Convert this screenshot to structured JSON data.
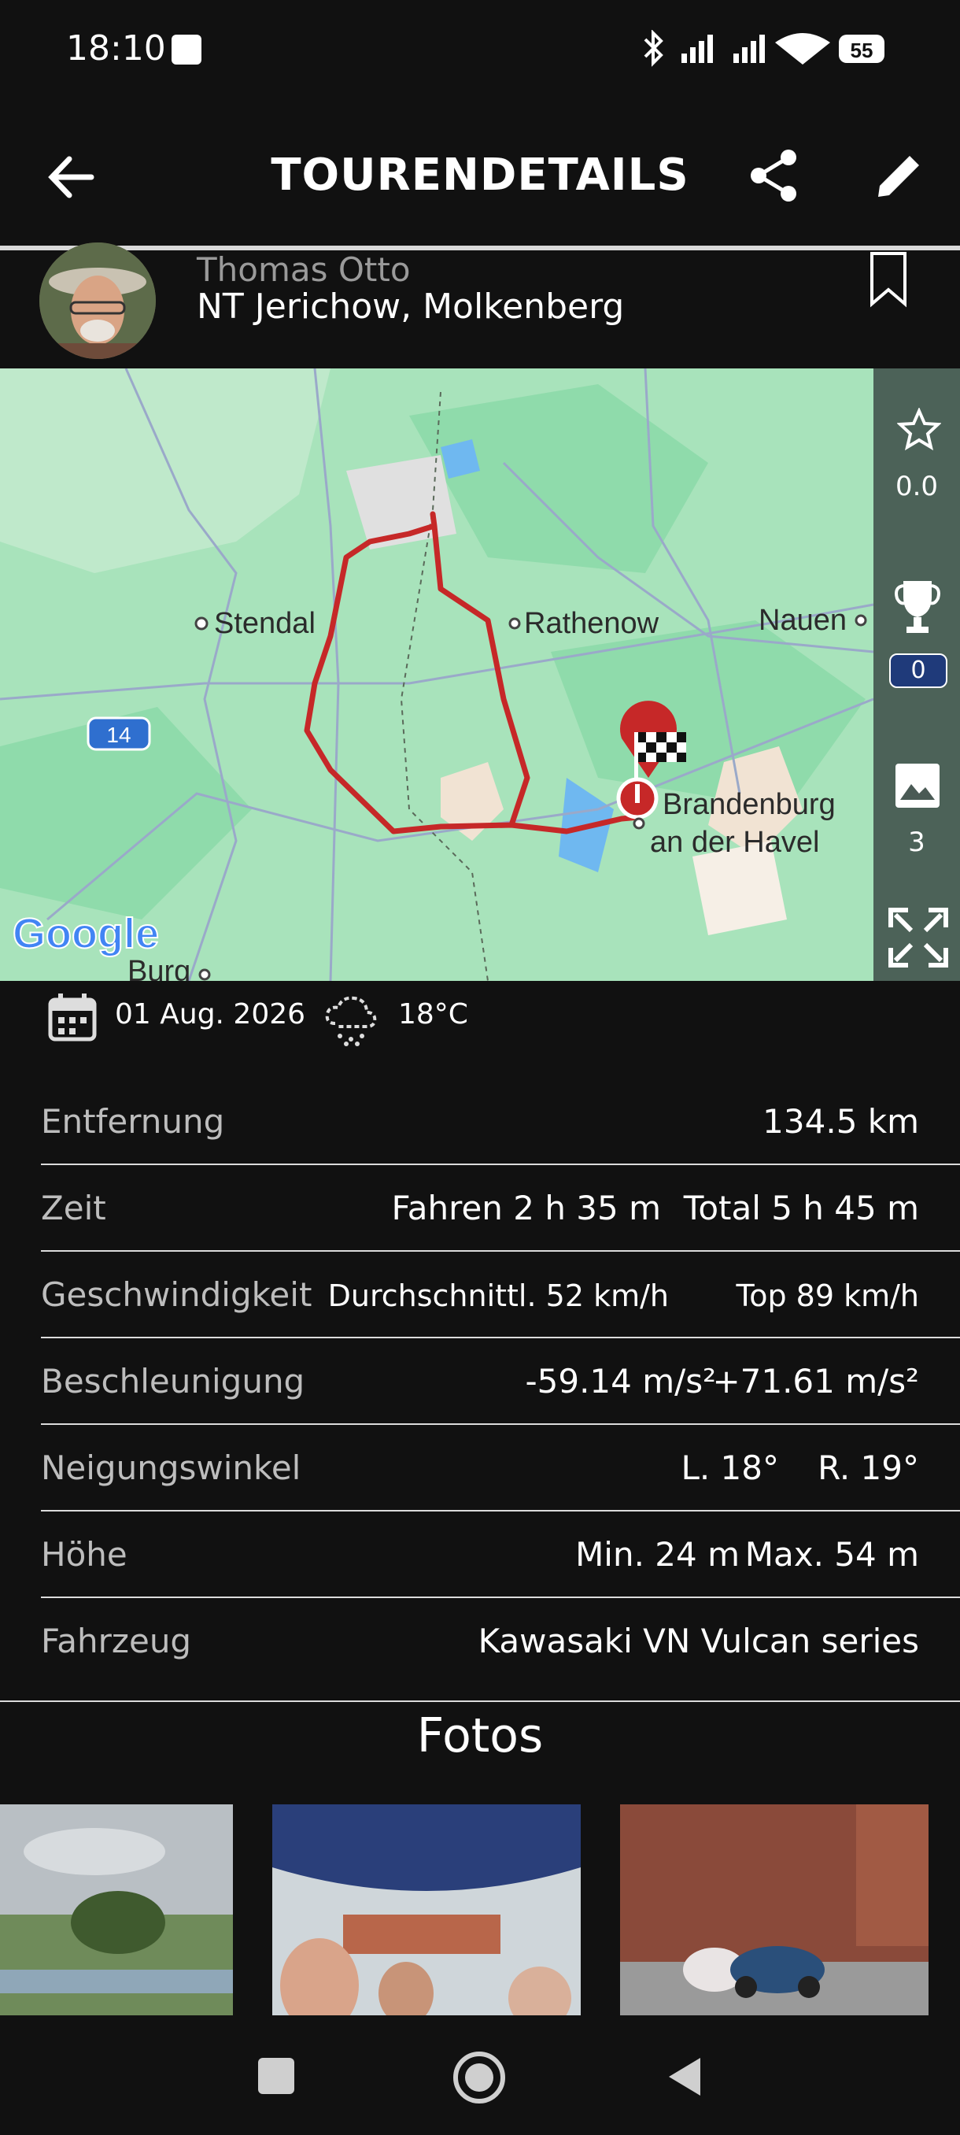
{
  "status_bar": {
    "time": "18:10",
    "battery": "55"
  },
  "app_bar": {
    "title": "TOURENDETAILS"
  },
  "tour": {
    "author": "Thomas Otto",
    "name": "NT Jerichow, Molkenberg"
  },
  "map": {
    "places": [
      "Stendal",
      "Rathenow",
      "Nauen",
      "Brandenburg",
      "an der Havel",
      "Burg"
    ],
    "road_badge": "14",
    "google_logo": "Google"
  },
  "side_panel": {
    "rating": "0.0",
    "trophies": "0",
    "photos": "3"
  },
  "meta": {
    "date": "01 Aug. 2026",
    "temperature": "18°C"
  },
  "stats": {
    "distance_label": "Entfernung",
    "distance": "134.5 km",
    "time_label": "Zeit",
    "time_driving": "Fahren 2 h 35 m",
    "time_total": "Total 5 h 45 m",
    "speed_label": "Geschwindigkeit",
    "speed_avg": "Durchschnittl. 52 km/h",
    "speed_top": "Top 89 km/h",
    "accel_label": "Beschleunigung",
    "accel_min": "-59.14 m/s²",
    "accel_max": "+71.61 m/s²",
    "lean_label": "Neigungswinkel",
    "lean_left": "L. 18°",
    "lean_right": "R. 19°",
    "height_label": "Höhe",
    "height_min": "Min. 24 m",
    "height_max": "Max. 54 m",
    "vehicle_label": "Fahrzeug",
    "vehicle": "Kawasaki VN Vulcan series"
  },
  "photos_section": {
    "title": "Fotos"
  },
  "colors": {
    "route": "#c62828",
    "map_green": "#a8e3bb",
    "background": "#111111"
  }
}
